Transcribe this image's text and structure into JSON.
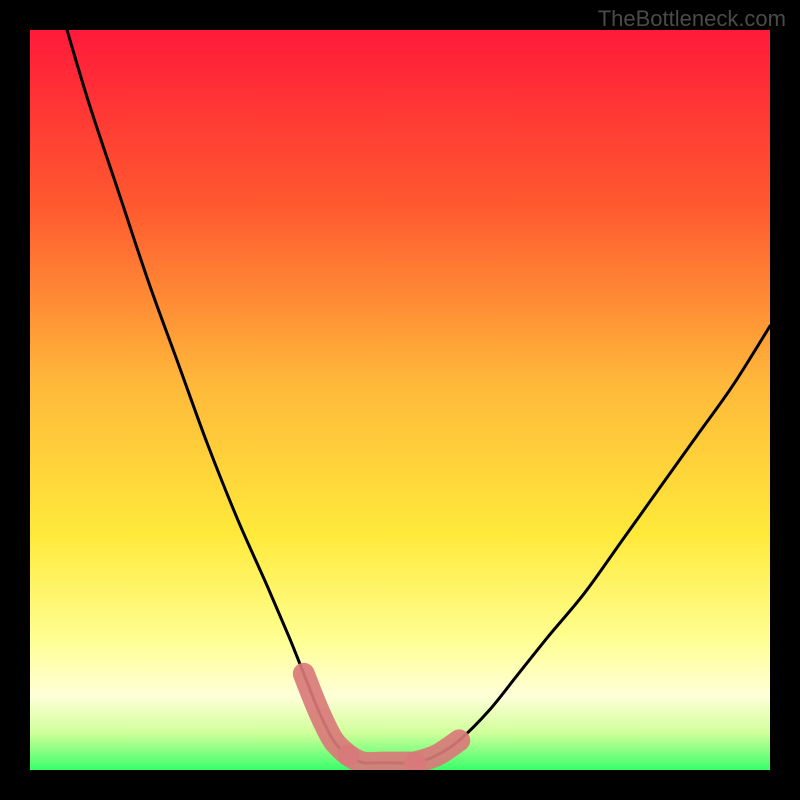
{
  "watermark": "TheBottleneck.com",
  "chart_data": {
    "type": "line",
    "title": "",
    "xlabel": "",
    "ylabel": "",
    "xlim": [
      0,
      100
    ],
    "ylim": [
      0,
      100
    ],
    "background_gradient": {
      "top": "#ff1a3a",
      "mid_upper": "#ff8a2a",
      "mid": "#ffe93a",
      "mid_lower": "#ffffc0",
      "bottom": "#3aff6a"
    },
    "series": [
      {
        "name": "curve",
        "color": "#000000",
        "x": [
          5,
          8,
          12,
          16,
          20,
          24,
          28,
          32,
          35,
          37,
          39,
          41,
          43,
          45,
          48,
          52,
          55,
          58,
          62,
          66,
          70,
          75,
          80,
          85,
          90,
          95,
          100
        ],
        "y": [
          100,
          90,
          78,
          66,
          55,
          44,
          34,
          25,
          18,
          13,
          8,
          4,
          2,
          1,
          1,
          1,
          2,
          4,
          8,
          13,
          18,
          24,
          31,
          38,
          45,
          52,
          60
        ]
      },
      {
        "name": "highlight-left",
        "color": "#d97a7a",
        "x": [
          37,
          39,
          41,
          43
        ],
        "y": [
          13,
          8,
          4,
          2
        ]
      },
      {
        "name": "highlight-bottom",
        "color": "#d97a7a",
        "x": [
          43,
          45,
          48,
          52
        ],
        "y": [
          2,
          1,
          1,
          1
        ]
      },
      {
        "name": "highlight-right",
        "color": "#d97a7a",
        "x": [
          52,
          55,
          58
        ],
        "y": [
          1,
          2,
          4
        ]
      }
    ]
  }
}
